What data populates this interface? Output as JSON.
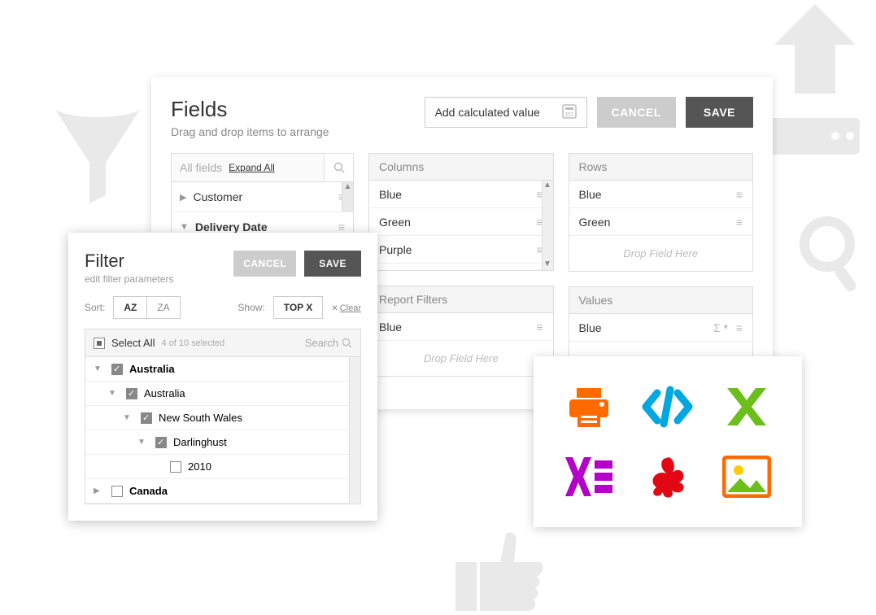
{
  "fields": {
    "title": "Fields",
    "subtitle": "Drag and drop items to arrange",
    "add_calc": "Add calculated value",
    "cancel": "CANCEL",
    "save": "SAVE",
    "all_fields_label": "All fields",
    "expand_all": "Expand All",
    "items": [
      {
        "label": "Customer",
        "expanded": false,
        "bold": false
      },
      {
        "label": "Delivery Date",
        "expanded": true,
        "bold": true
      }
    ],
    "zones": {
      "columns": {
        "title": "Columns",
        "items": [
          "Blue",
          "Green",
          "Purple"
        ]
      },
      "rows": {
        "title": "Rows",
        "items": [
          "Blue",
          "Green"
        ],
        "drop_hint": "Drop Field Here"
      },
      "filters": {
        "title": "Report Filters",
        "items": [
          "Blue"
        ],
        "drop_hint": "Drop Field Here"
      },
      "values": {
        "title": "Values",
        "items": [
          "Blue"
        ]
      }
    }
  },
  "filter": {
    "title": "Filter",
    "subtitle": "edit filter parameters",
    "cancel": "CANCEL",
    "save": "SAVE",
    "sort_label": "Sort:",
    "sort_az": "AZ",
    "sort_za": "ZA",
    "show_label": "Show:",
    "topx": "TOP X",
    "clear": "Clear",
    "select_all": "Select All",
    "selected_count": "4 of 10 selected",
    "search": "Search",
    "tree": [
      {
        "label": "Australia",
        "checked": true,
        "indent": 0,
        "bold": true,
        "expanded": true
      },
      {
        "label": "Australia",
        "checked": true,
        "indent": 1,
        "bold": false,
        "expanded": true
      },
      {
        "label": "New South Wales",
        "checked": true,
        "indent": 2,
        "bold": false,
        "expanded": true
      },
      {
        "label": "Darlinghust",
        "checked": true,
        "indent": 3,
        "bold": false,
        "expanded": true
      },
      {
        "label": "2010",
        "checked": false,
        "indent": 4,
        "bold": false,
        "expanded": false
      },
      {
        "label": "Canada",
        "checked": false,
        "indent": 0,
        "bold": true,
        "expanded": false
      }
    ]
  },
  "export_icons": [
    "print",
    "code",
    "excel",
    "chart-bar",
    "pdf",
    "image"
  ]
}
